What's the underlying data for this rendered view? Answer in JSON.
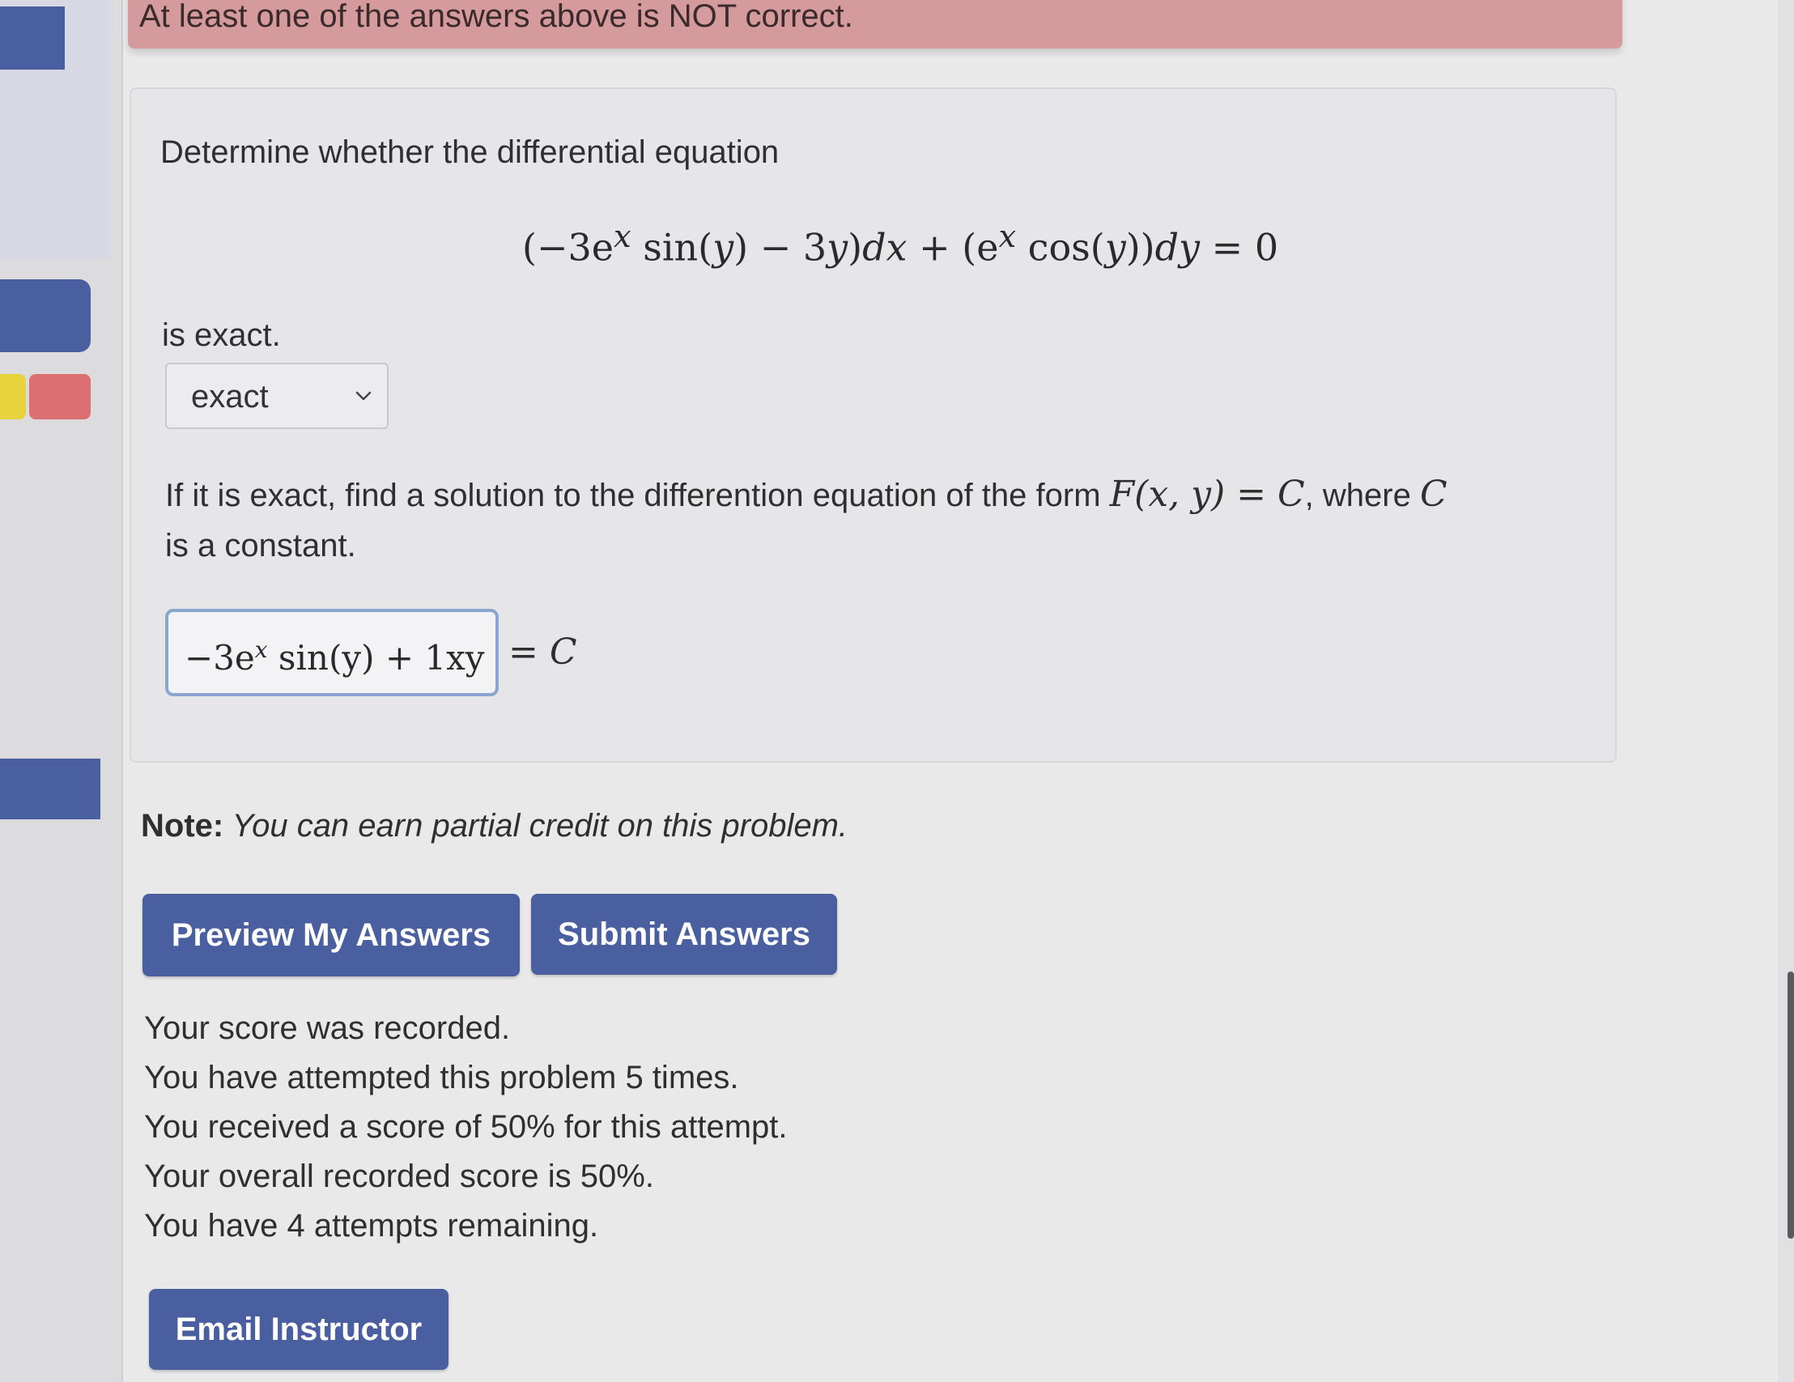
{
  "banner": {
    "message": "At least one of the answers above is NOT correct."
  },
  "problem": {
    "intro": "Determine whether the differential equation",
    "equation": {
      "p1": "(−3e",
      "sup1": "x",
      "p2": " sin(",
      "y1": "y",
      "p3": ") − 3",
      "y2": "y",
      "p4": ")",
      "dx": "dx",
      "p5": " + (e",
      "sup2": "x",
      "p6": " cos(",
      "y3": "y",
      "p7": "))",
      "dy": "dy",
      "p8": " = 0"
    },
    "is_exact_text": "is exact.",
    "select": {
      "value": "exact"
    },
    "prompt": {
      "t1": "If it is exact, find a solution to the differention equation of the form ",
      "m1": "F(x, y) = C",
      "t2": ", where ",
      "m2": "C",
      "t3": " is a constant."
    },
    "answer": {
      "p1": "−3e",
      "sup": "x",
      "p2": " sin(y) + 1xy",
      "suffix_eq": "= ",
      "suffix_c": "C"
    }
  },
  "note": {
    "label": "Note:",
    "text": " You can earn partial credit on this problem."
  },
  "buttons": {
    "preview": "Preview My Answers",
    "submit": "Submit Answers",
    "email": "Email Instructor"
  },
  "status": [
    "Your score was recorded.",
    "You have attempted this problem 5 times.",
    "You received a score of 50% for this attempt.",
    "Your overall recorded score is 50%.",
    "You have 4 attempts remaining."
  ],
  "colors": {
    "primary_button": "#4a5fa0",
    "error_banner": "#d59a9c",
    "answer_border": "#8aa6d0"
  },
  "icons": {
    "select_chevron": "chevron-down-icon"
  }
}
